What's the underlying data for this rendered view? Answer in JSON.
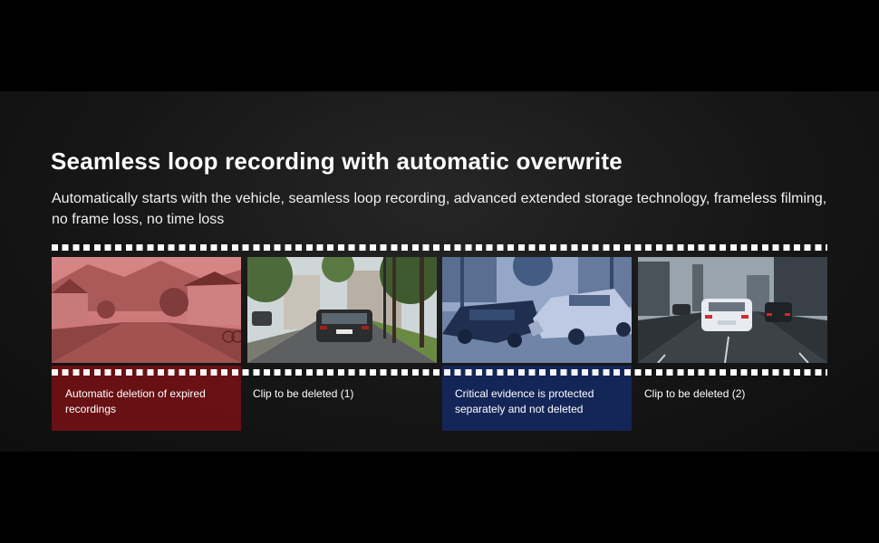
{
  "header": {
    "title": "Seamless loop recording with automatic overwrite",
    "subtitle": "Automatically starts with the vehicle, seamless loop recording, advanced extended storage technology, frameless filming, no frame loss, no time loss"
  },
  "clips": [
    {
      "caption": "Automatic deletion of expired recordings",
      "highlight": "red"
    },
    {
      "caption": "Clip to be deleted (1)",
      "highlight": "none"
    },
    {
      "caption": "Critical evidence is protected separately and not deleted",
      "highlight": "blue"
    },
    {
      "caption": "Clip to be deleted (2)",
      "highlight": "none"
    }
  ],
  "colors": {
    "deleted_highlight": "#7a1418",
    "protected_highlight": "#14285f",
    "background": "#161616"
  }
}
